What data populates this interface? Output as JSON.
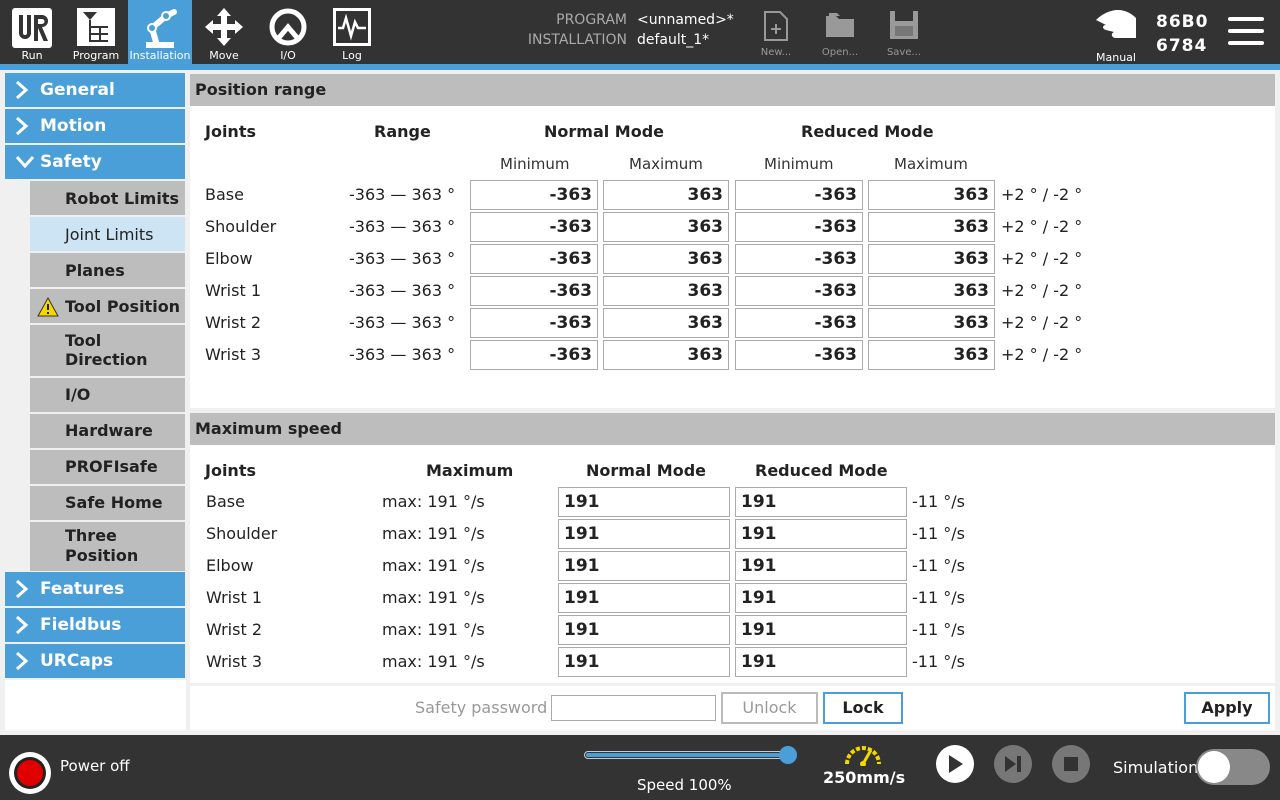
{
  "nav": {
    "run": "Run",
    "program": "Program",
    "installation": "Installation",
    "move": "Move",
    "io": "I/O",
    "log": "Log"
  },
  "header": {
    "program_label": "PROGRAM",
    "program_value": "<unnamed>*",
    "installation_label": "INSTALLATION",
    "installation_value": "default_1*",
    "new": "New...",
    "open": "Open...",
    "save": "Save...",
    "mode": "Manual",
    "serial_line1": "86B0",
    "serial_line2": "6784"
  },
  "sidebar": {
    "general": "General",
    "motion": "Motion",
    "safety": "Safety",
    "safety_items": [
      {
        "label": "Robot Limits"
      },
      {
        "label": "Joint Limits"
      },
      {
        "label": "Planes"
      },
      {
        "label": "Tool Position"
      },
      {
        "label_1": "Tool",
        "label_2": "Direction"
      },
      {
        "label": "I/O"
      },
      {
        "label": "Hardware"
      },
      {
        "label": "PROFIsafe"
      },
      {
        "label": "Safe Home"
      },
      {
        "label_1": "Three",
        "label_2": "Position"
      }
    ],
    "features": "Features",
    "fieldbus": "Fieldbus",
    "urcaps": "URCaps"
  },
  "position_range": {
    "title": "Position range",
    "headers": {
      "joints": "Joints",
      "range": "Range",
      "normal_mode": "Normal Mode",
      "reduced_mode": "Reduced Mode",
      "minimum": "Minimum",
      "maximum": "Maximum"
    },
    "rows": [
      {
        "joint": "Base",
        "range": "-363 — 363 °",
        "normal_min": "-363",
        "normal_max": "363",
        "reduced_min": "-363",
        "reduced_max": "363",
        "tolerance": "+2 ° / -2 °"
      },
      {
        "joint": "Shoulder",
        "range": "-363 — 363 °",
        "normal_min": "-363",
        "normal_max": "363",
        "reduced_min": "-363",
        "reduced_max": "363",
        "tolerance": "+2 ° / -2 °"
      },
      {
        "joint": "Elbow",
        "range": "-363 — 363 °",
        "normal_min": "-363",
        "normal_max": "363",
        "reduced_min": "-363",
        "reduced_max": "363",
        "tolerance": "+2 ° / -2 °"
      },
      {
        "joint": "Wrist 1",
        "range": "-363 — 363 °",
        "normal_min": "-363",
        "normal_max": "363",
        "reduced_min": "-363",
        "reduced_max": "363",
        "tolerance": "+2 ° / -2 °"
      },
      {
        "joint": "Wrist 2",
        "range": "-363 — 363 °",
        "normal_min": "-363",
        "normal_max": "363",
        "reduced_min": "-363",
        "reduced_max": "363",
        "tolerance": "+2 ° / -2 °"
      },
      {
        "joint": "Wrist 3",
        "range": "-363 — 363 °",
        "normal_min": "-363",
        "normal_max": "363",
        "reduced_min": "-363",
        "reduced_max": "363",
        "tolerance": "+2 ° / -2 °"
      }
    ]
  },
  "max_speed": {
    "title": "Maximum speed",
    "headers": {
      "joints": "Joints",
      "maximum": "Maximum",
      "normal_mode": "Normal Mode",
      "reduced_mode": "Reduced Mode"
    },
    "rows": [
      {
        "joint": "Base",
        "max": "max: 191 °/s",
        "normal": "191",
        "reduced": "191",
        "tolerance": "-11 °/s"
      },
      {
        "joint": "Shoulder",
        "max": "max: 191 °/s",
        "normal": "191",
        "reduced": "191",
        "tolerance": "-11 °/s"
      },
      {
        "joint": "Elbow",
        "max": "max: 191 °/s",
        "normal": "191",
        "reduced": "191",
        "tolerance": "-11 °/s"
      },
      {
        "joint": "Wrist 1",
        "max": "max: 191 °/s",
        "normal": "191",
        "reduced": "191",
        "tolerance": "-11 °/s"
      },
      {
        "joint": "Wrist 2",
        "max": "max: 191 °/s",
        "normal": "191",
        "reduced": "191",
        "tolerance": "-11 °/s"
      },
      {
        "joint": "Wrist 3",
        "max": "max: 191 °/s",
        "normal": "191",
        "reduced": "191",
        "tolerance": "-11 °/s"
      }
    ]
  },
  "password": {
    "label": "Safety password",
    "value": "",
    "unlock": "Unlock",
    "lock": "Lock",
    "apply": "Apply"
  },
  "footer": {
    "power": "Power off",
    "speed_label": "Speed 100%",
    "speed_fraction": 1.0,
    "tcp_speed": "250mm/s",
    "simulation": "Simulation",
    "simulation_on": false
  },
  "colors": {
    "accent": "#4a9fd8",
    "dark": "#333333",
    "selected": "#cde4f5",
    "power": "#e10000"
  }
}
